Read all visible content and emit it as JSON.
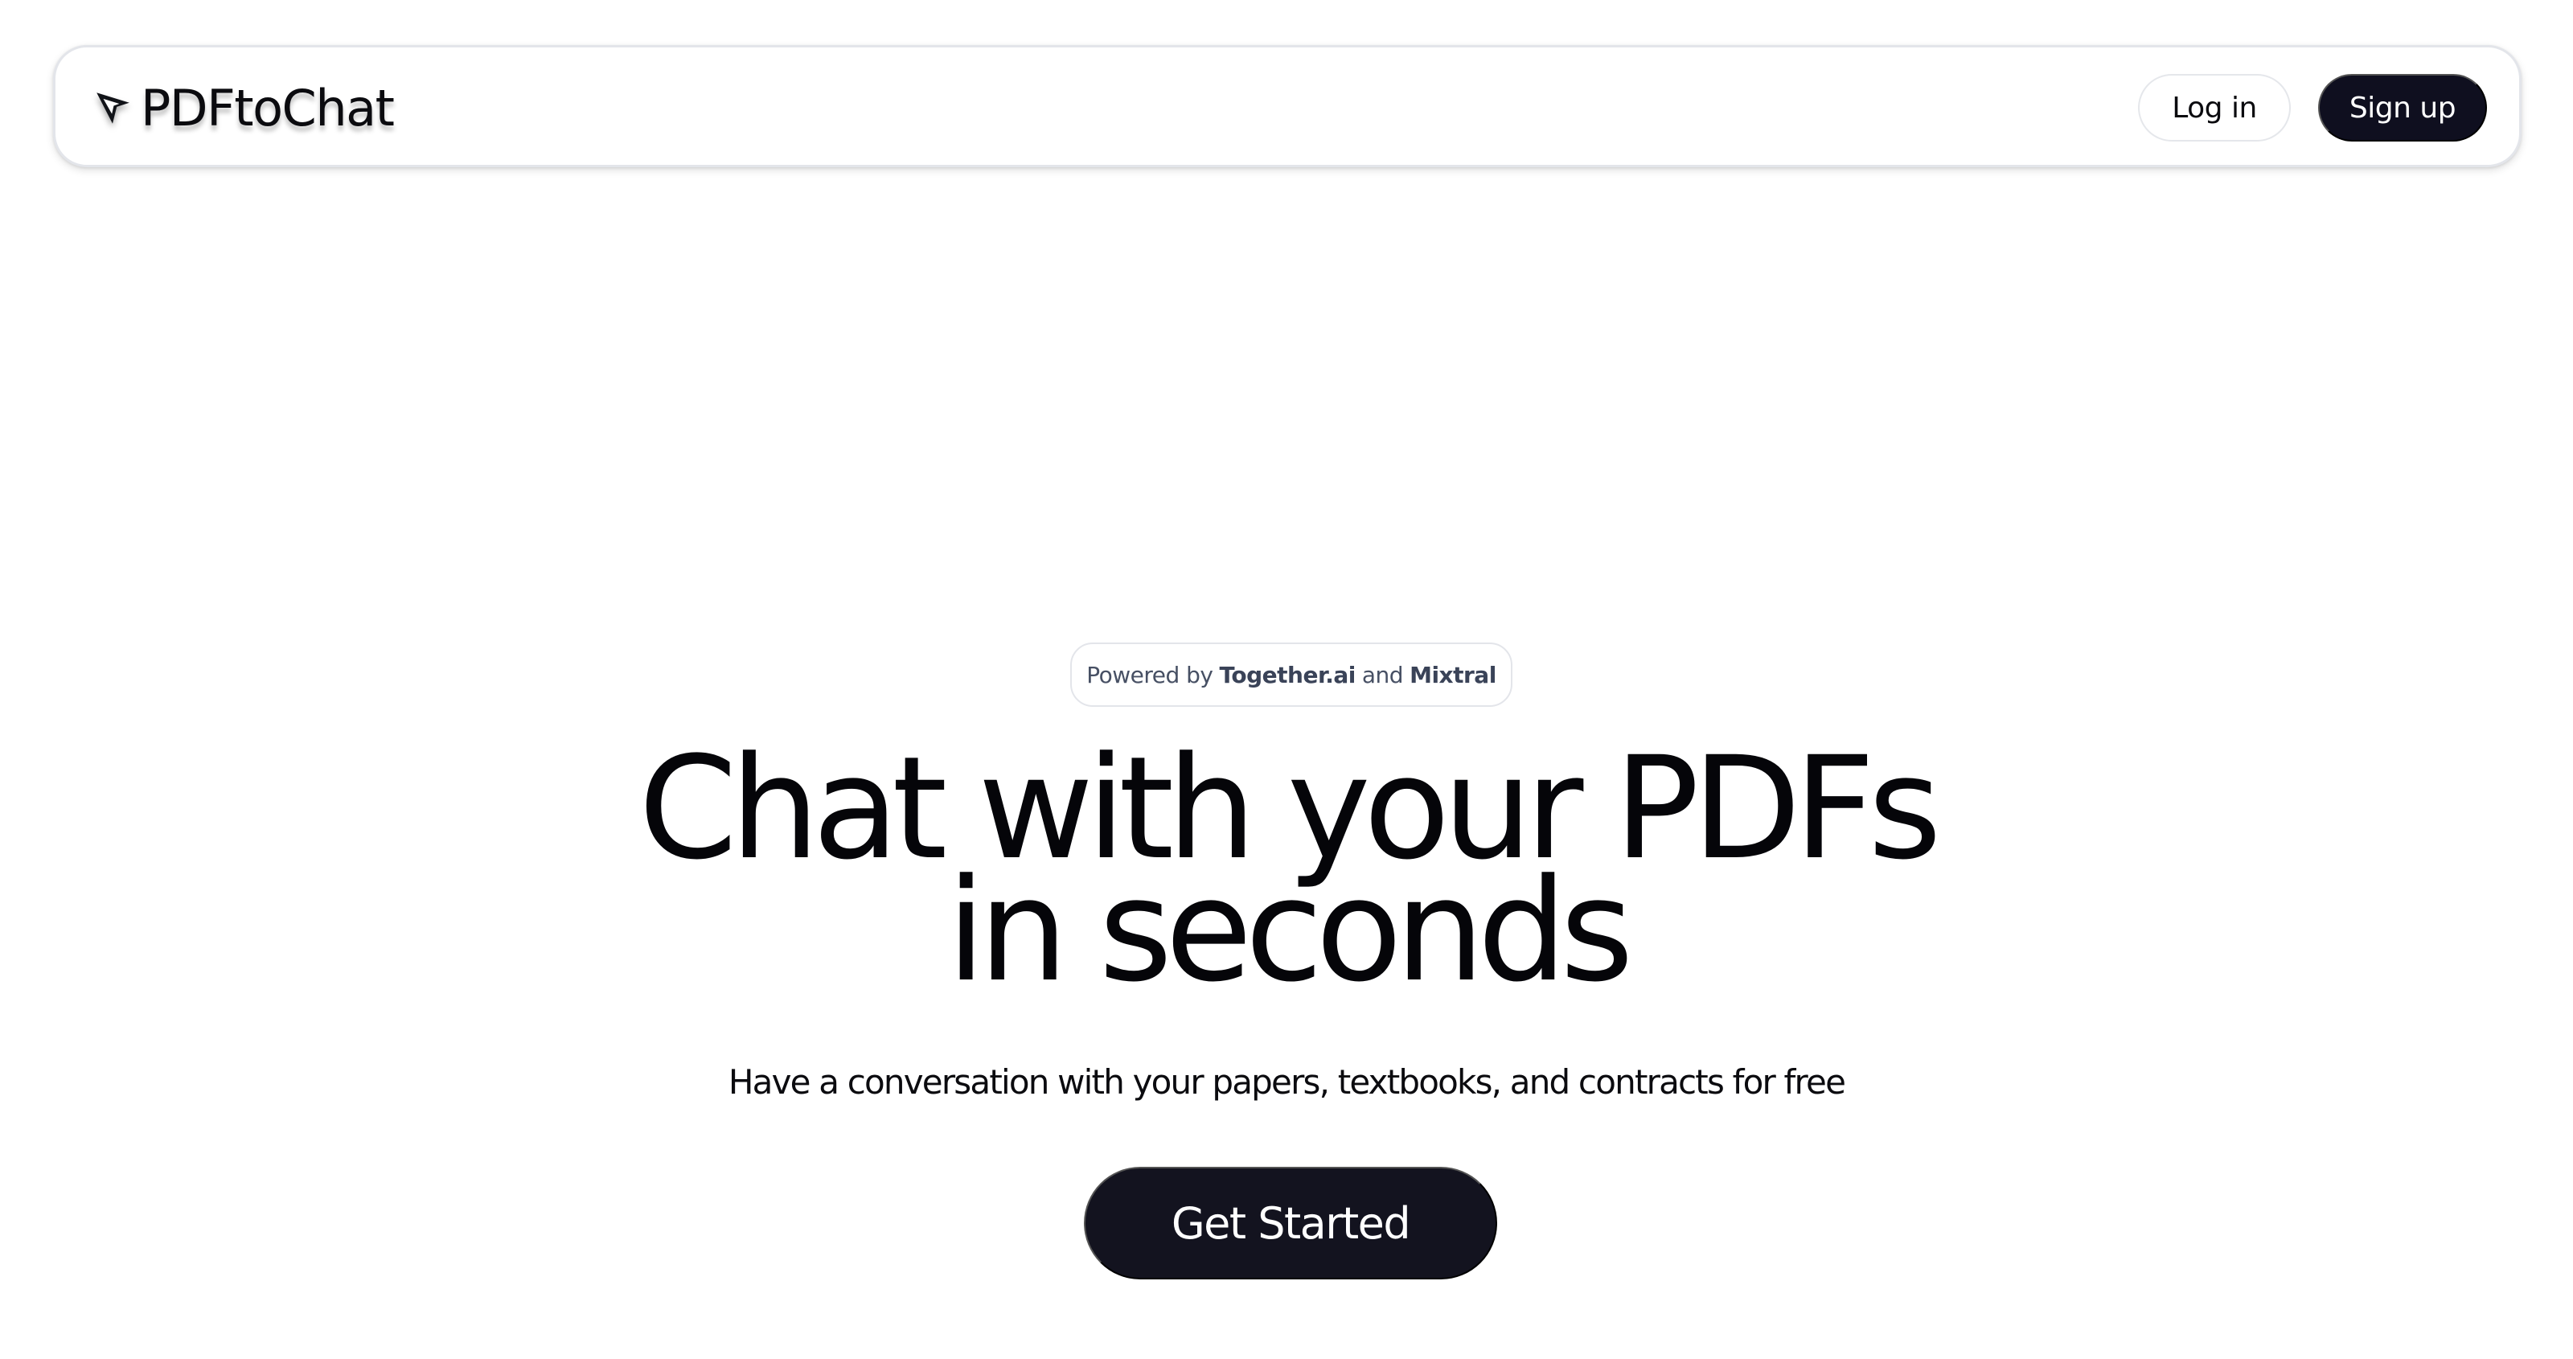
{
  "header": {
    "logo_text": "PDFtoChat",
    "login_label": "Log in",
    "signup_label": "Sign up"
  },
  "hero": {
    "badge": {
      "prefix": "Powered by",
      "brand1": "Together.ai",
      "conjunction": "and",
      "brand2": "Mixtral"
    },
    "headline_line1": "Chat with your PDFs",
    "headline_line2": "in seconds",
    "subtitle": "Have a conversation with your papers, textbooks, and contracts for free",
    "cta_label": "Get Started"
  },
  "icons": {
    "logo": "cursor-arrow-icon"
  },
  "colors": {
    "primary_dark": "#0f0f1f",
    "background": "#ffffff",
    "badge_text": "#475064"
  }
}
